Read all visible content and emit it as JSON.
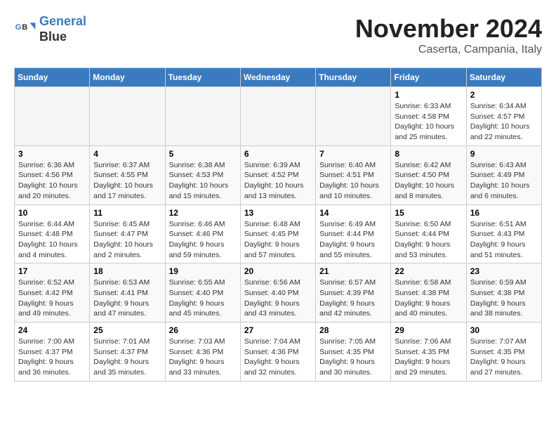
{
  "header": {
    "logo_line1": "General",
    "logo_line2": "Blue",
    "month_title": "November 2024",
    "subtitle": "Caserta, Campania, Italy"
  },
  "weekdays": [
    "Sunday",
    "Monday",
    "Tuesday",
    "Wednesday",
    "Thursday",
    "Friday",
    "Saturday"
  ],
  "weeks": [
    [
      {
        "day": "",
        "empty": true
      },
      {
        "day": "",
        "empty": true
      },
      {
        "day": "",
        "empty": true
      },
      {
        "day": "",
        "empty": true
      },
      {
        "day": "",
        "empty": true
      },
      {
        "day": "1",
        "sunrise": "Sunrise: 6:33 AM",
        "sunset": "Sunset: 4:58 PM",
        "daylight": "Daylight: 10 hours and 25 minutes."
      },
      {
        "day": "2",
        "sunrise": "Sunrise: 6:34 AM",
        "sunset": "Sunset: 4:57 PM",
        "daylight": "Daylight: 10 hours and 22 minutes."
      }
    ],
    [
      {
        "day": "3",
        "sunrise": "Sunrise: 6:36 AM",
        "sunset": "Sunset: 4:56 PM",
        "daylight": "Daylight: 10 hours and 20 minutes."
      },
      {
        "day": "4",
        "sunrise": "Sunrise: 6:37 AM",
        "sunset": "Sunset: 4:55 PM",
        "daylight": "Daylight: 10 hours and 17 minutes."
      },
      {
        "day": "5",
        "sunrise": "Sunrise: 6:38 AM",
        "sunset": "Sunset: 4:53 PM",
        "daylight": "Daylight: 10 hours and 15 minutes."
      },
      {
        "day": "6",
        "sunrise": "Sunrise: 6:39 AM",
        "sunset": "Sunset: 4:52 PM",
        "daylight": "Daylight: 10 hours and 13 minutes."
      },
      {
        "day": "7",
        "sunrise": "Sunrise: 6:40 AM",
        "sunset": "Sunset: 4:51 PM",
        "daylight": "Daylight: 10 hours and 10 minutes."
      },
      {
        "day": "8",
        "sunrise": "Sunrise: 6:42 AM",
        "sunset": "Sunset: 4:50 PM",
        "daylight": "Daylight: 10 hours and 8 minutes."
      },
      {
        "day": "9",
        "sunrise": "Sunrise: 6:43 AM",
        "sunset": "Sunset: 4:49 PM",
        "daylight": "Daylight: 10 hours and 6 minutes."
      }
    ],
    [
      {
        "day": "10",
        "sunrise": "Sunrise: 6:44 AM",
        "sunset": "Sunset: 4:48 PM",
        "daylight": "Daylight: 10 hours and 4 minutes."
      },
      {
        "day": "11",
        "sunrise": "Sunrise: 6:45 AM",
        "sunset": "Sunset: 4:47 PM",
        "daylight": "Daylight: 10 hours and 2 minutes."
      },
      {
        "day": "12",
        "sunrise": "Sunrise: 6:46 AM",
        "sunset": "Sunset: 4:46 PM",
        "daylight": "Daylight: 9 hours and 59 minutes."
      },
      {
        "day": "13",
        "sunrise": "Sunrise: 6:48 AM",
        "sunset": "Sunset: 4:45 PM",
        "daylight": "Daylight: 9 hours and 57 minutes."
      },
      {
        "day": "14",
        "sunrise": "Sunrise: 6:49 AM",
        "sunset": "Sunset: 4:44 PM",
        "daylight": "Daylight: 9 hours and 55 minutes."
      },
      {
        "day": "15",
        "sunrise": "Sunrise: 6:50 AM",
        "sunset": "Sunset: 4:44 PM",
        "daylight": "Daylight: 9 hours and 53 minutes."
      },
      {
        "day": "16",
        "sunrise": "Sunrise: 6:51 AM",
        "sunset": "Sunset: 4:43 PM",
        "daylight": "Daylight: 9 hours and 51 minutes."
      }
    ],
    [
      {
        "day": "17",
        "sunrise": "Sunrise: 6:52 AM",
        "sunset": "Sunset: 4:42 PM",
        "daylight": "Daylight: 9 hours and 49 minutes."
      },
      {
        "day": "18",
        "sunrise": "Sunrise: 6:53 AM",
        "sunset": "Sunset: 4:41 PM",
        "daylight": "Daylight: 9 hours and 47 minutes."
      },
      {
        "day": "19",
        "sunrise": "Sunrise: 6:55 AM",
        "sunset": "Sunset: 4:40 PM",
        "daylight": "Daylight: 9 hours and 45 minutes."
      },
      {
        "day": "20",
        "sunrise": "Sunrise: 6:56 AM",
        "sunset": "Sunset: 4:40 PM",
        "daylight": "Daylight: 9 hours and 43 minutes."
      },
      {
        "day": "21",
        "sunrise": "Sunrise: 6:57 AM",
        "sunset": "Sunset: 4:39 PM",
        "daylight": "Daylight: 9 hours and 42 minutes."
      },
      {
        "day": "22",
        "sunrise": "Sunrise: 6:58 AM",
        "sunset": "Sunset: 4:38 PM",
        "daylight": "Daylight: 9 hours and 40 minutes."
      },
      {
        "day": "23",
        "sunrise": "Sunrise: 6:59 AM",
        "sunset": "Sunset: 4:38 PM",
        "daylight": "Daylight: 9 hours and 38 minutes."
      }
    ],
    [
      {
        "day": "24",
        "sunrise": "Sunrise: 7:00 AM",
        "sunset": "Sunset: 4:37 PM",
        "daylight": "Daylight: 9 hours and 36 minutes."
      },
      {
        "day": "25",
        "sunrise": "Sunrise: 7:01 AM",
        "sunset": "Sunset: 4:37 PM",
        "daylight": "Daylight: 9 hours and 35 minutes."
      },
      {
        "day": "26",
        "sunrise": "Sunrise: 7:03 AM",
        "sunset": "Sunset: 4:36 PM",
        "daylight": "Daylight: 9 hours and 33 minutes."
      },
      {
        "day": "27",
        "sunrise": "Sunrise: 7:04 AM",
        "sunset": "Sunset: 4:36 PM",
        "daylight": "Daylight: 9 hours and 32 minutes."
      },
      {
        "day": "28",
        "sunrise": "Sunrise: 7:05 AM",
        "sunset": "Sunset: 4:35 PM",
        "daylight": "Daylight: 9 hours and 30 minutes."
      },
      {
        "day": "29",
        "sunrise": "Sunrise: 7:06 AM",
        "sunset": "Sunset: 4:35 PM",
        "daylight": "Daylight: 9 hours and 29 minutes."
      },
      {
        "day": "30",
        "sunrise": "Sunrise: 7:07 AM",
        "sunset": "Sunset: 4:35 PM",
        "daylight": "Daylight: 9 hours and 27 minutes."
      }
    ]
  ]
}
